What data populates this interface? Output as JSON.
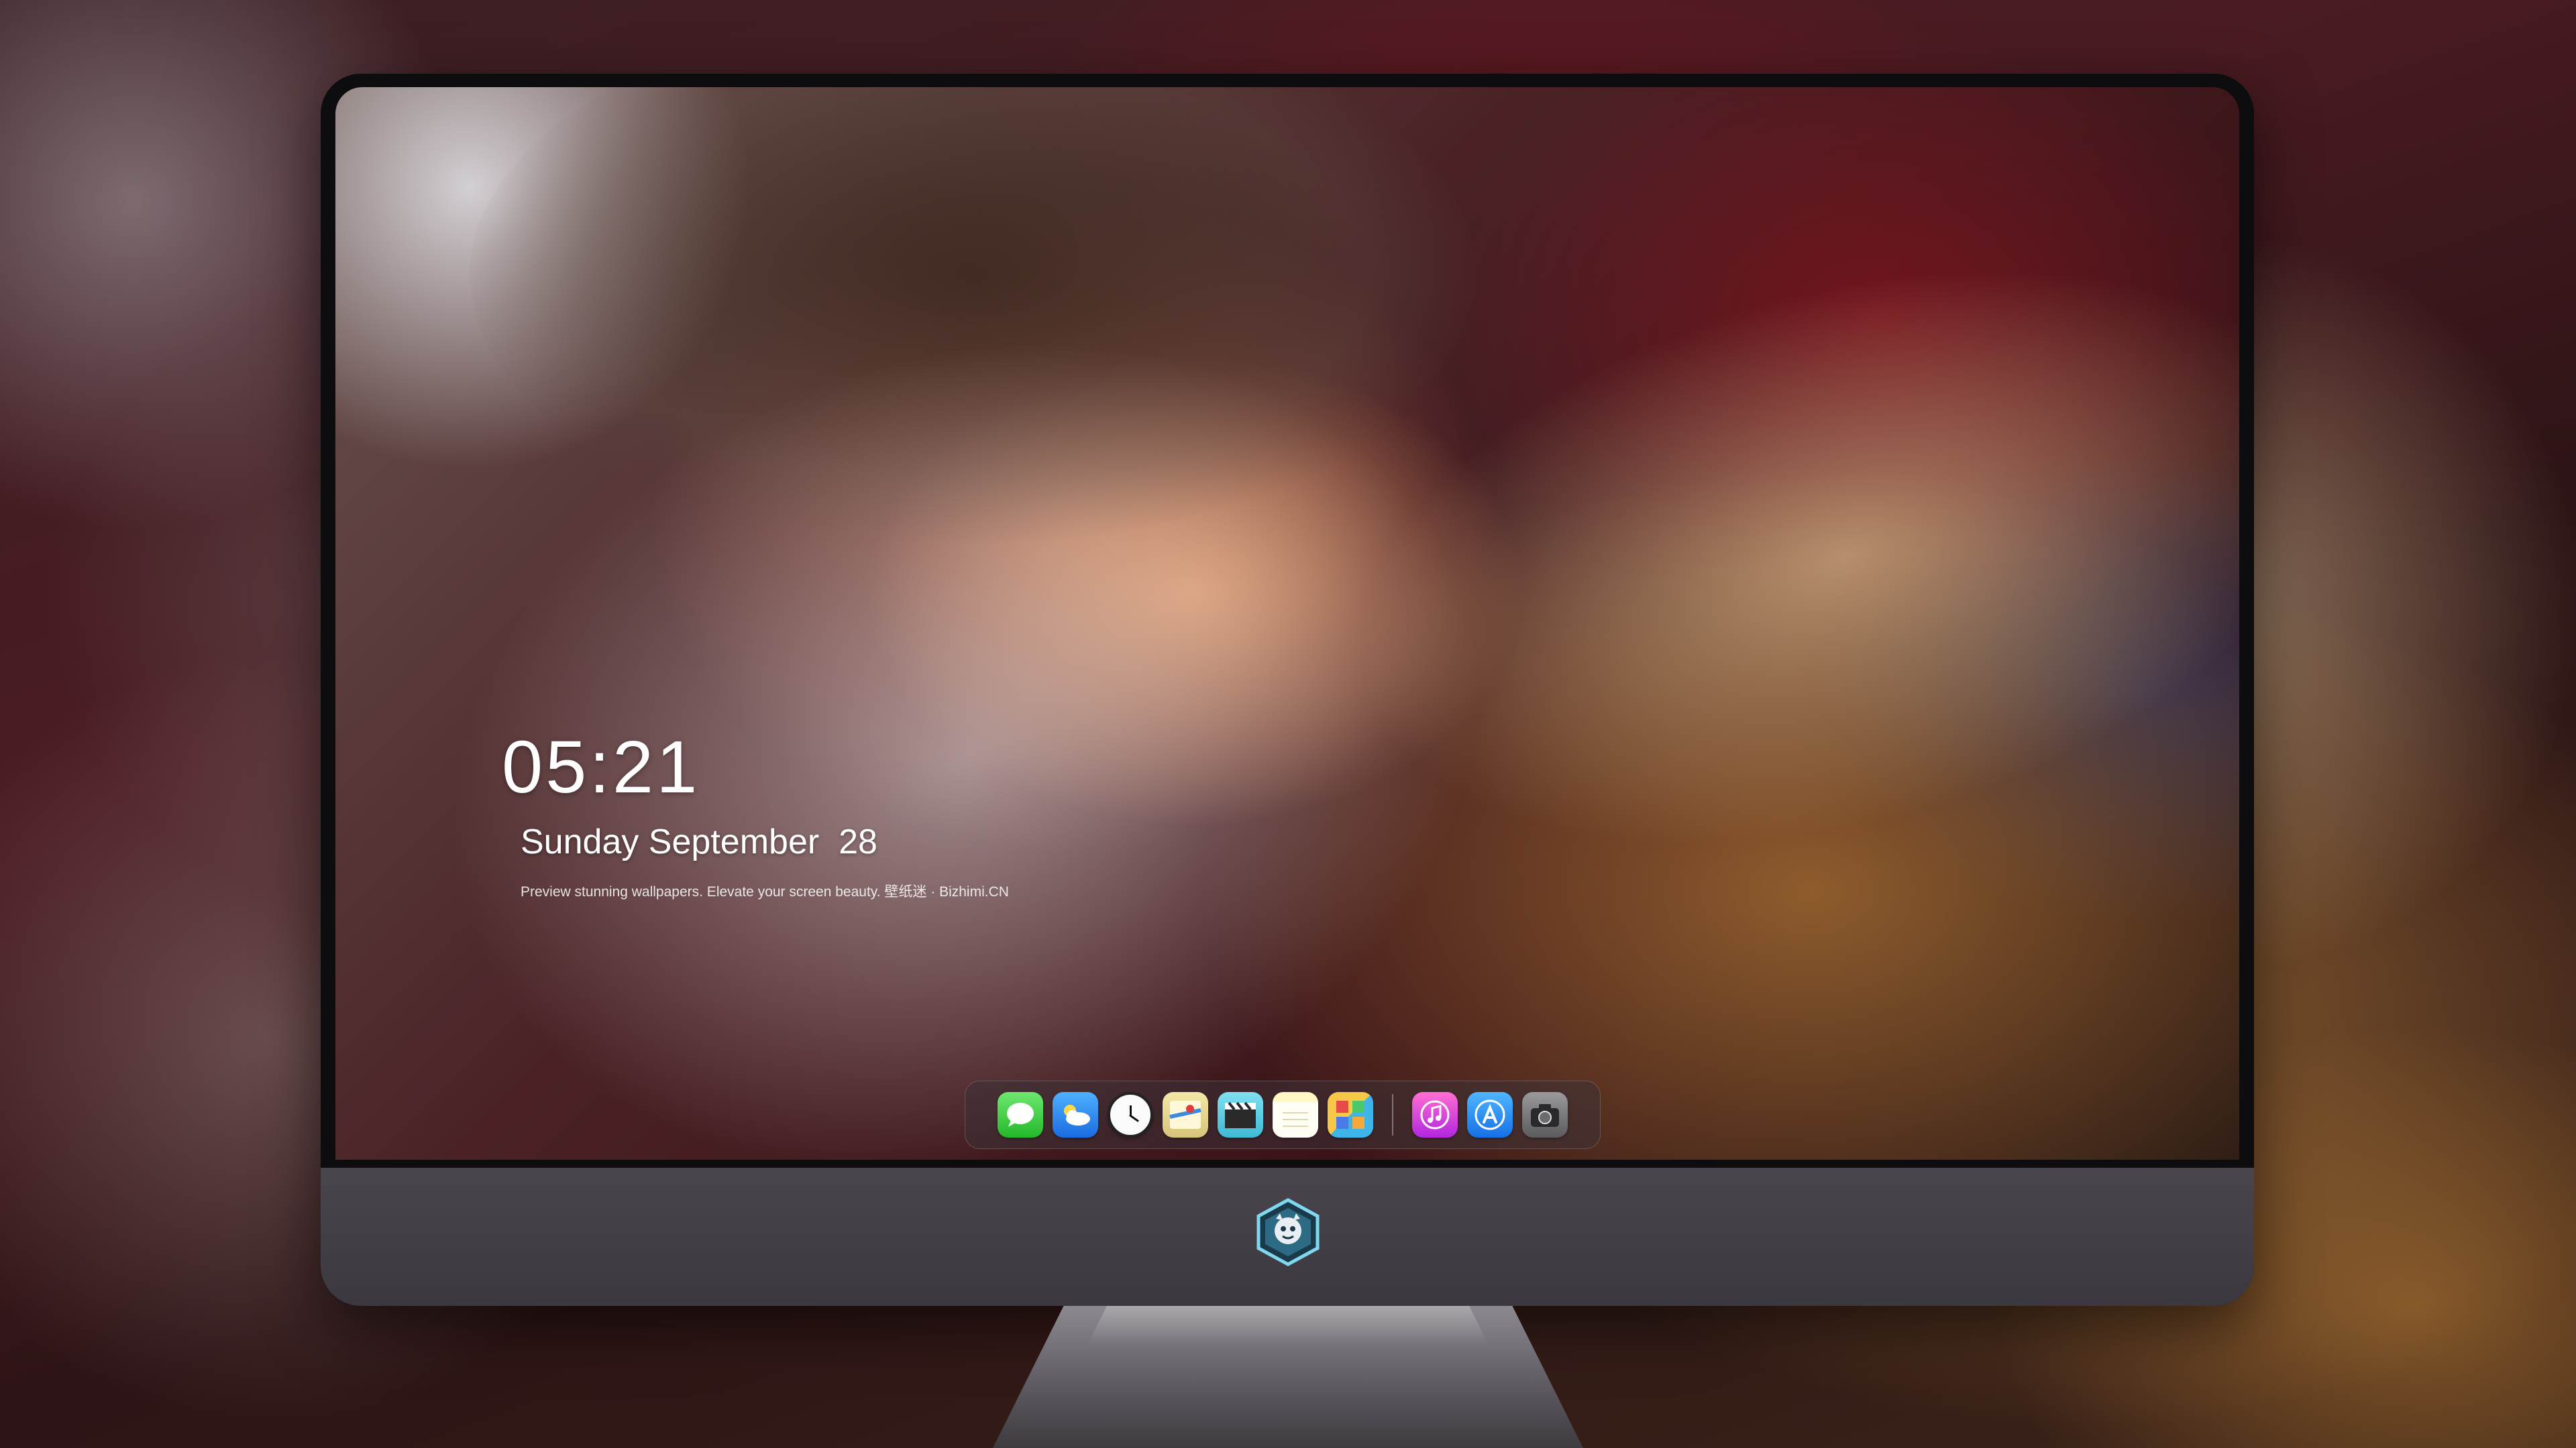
{
  "lockscreen": {
    "time": "05:21",
    "date": "Sunday September  28",
    "tagline": "Preview stunning wallpapers. Elevate your screen beauty. 壁纸迷 · Bizhimi.CN"
  },
  "dock": {
    "apps": [
      {
        "name": "messages-app",
        "icon": "chat-bubble-icon",
        "color": "#23b82a"
      },
      {
        "name": "weather-app",
        "icon": "cloud-icon",
        "color": "#1a6be0"
      },
      {
        "name": "clock-app",
        "icon": "clock-icon",
        "color": "#fafafa"
      },
      {
        "name": "maps-app",
        "icon": "map-icon",
        "color": "#d7c47a"
      },
      {
        "name": "videos-app",
        "icon": "clapperboard-icon",
        "color": "#3fb9d6"
      },
      {
        "name": "notes-app",
        "icon": "notepad-icon",
        "color": "#fff7c4"
      },
      {
        "name": "gallery-app",
        "icon": "photos-icon",
        "color": "#f7c748"
      },
      {
        "name": "music-app",
        "icon": "music-note-icon",
        "color": "#b226e0"
      },
      {
        "name": "app-store-app",
        "icon": "app-store-icon",
        "color": "#1670e6"
      },
      {
        "name": "camera-app",
        "icon": "camera-icon",
        "color": "#5a5a5f"
      }
    ]
  },
  "monitor": {
    "logo": "dragon-mascot-logo"
  }
}
